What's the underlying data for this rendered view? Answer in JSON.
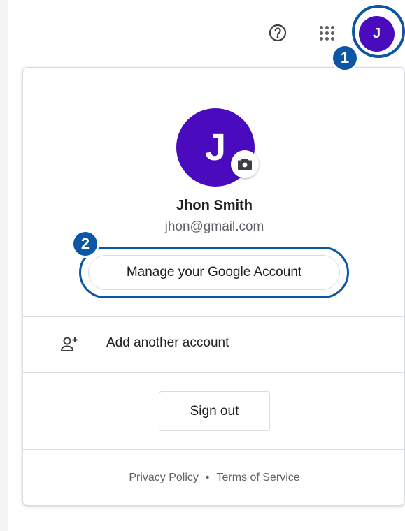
{
  "topbar": {
    "help_icon": "help-circle-icon",
    "apps_icon": "apps-grid-icon",
    "avatar_letter": "J"
  },
  "callouts": {
    "first": "1",
    "second": "2"
  },
  "account_menu": {
    "avatar_letter": "J",
    "camera_icon": "camera-icon",
    "name": "Jhon Smith",
    "email": "jhon@gmail.com",
    "manage_button_label": "Manage your Google Account",
    "add_account_icon": "add-person-icon",
    "add_account_label": "Add another account",
    "sign_out_label": "Sign out",
    "footer": {
      "privacy_label": "Privacy Policy",
      "separator": "•",
      "terms_label": "Terms of Service"
    }
  },
  "colors": {
    "avatar_bg": "#4a0bbf",
    "highlight": "#0b57a4"
  }
}
